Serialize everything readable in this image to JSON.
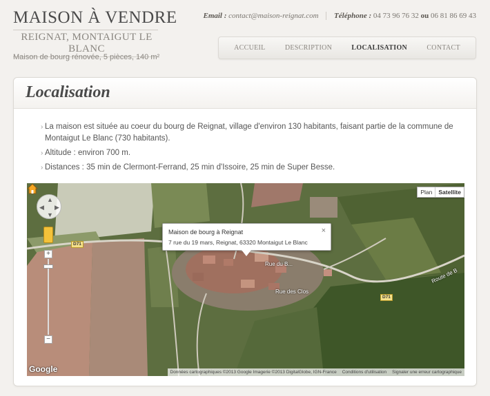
{
  "header": {
    "title": "MAISON À VENDRE",
    "subtitle": "REIGNAT, MONTAIGUT LE BLANC",
    "tagline": "Maison de bourg rénovée, 5 pièces, 140 m²",
    "email_label": "Email :",
    "email": "contact@maison-reignat.com",
    "phone_label": "Téléphone :",
    "phone1": "04 73 96 76 32",
    "or": "ou",
    "phone2": "06 81 86 69 43"
  },
  "nav": {
    "items": [
      "ACCUEIL",
      "DESCRIPTION",
      "LOCALISATION",
      "CONTACT"
    ],
    "active": "LOCALISATION"
  },
  "section": {
    "title": "Localisation",
    "bullets": [
      "La maison est située au coeur du bourg de Reignat, village d'environ 130 habitants, faisant partie de la commune de Montaigut Le Blanc (730 habitants).",
      "Altitude : environ 700 m.",
      "Distances : 35 min de Clermont-Ferrand, 25 min d'Issoire, 25 min de Super Besse."
    ]
  },
  "map": {
    "type_plan": "Plan",
    "type_satellite": "Satellite",
    "info_title": "Maison de bourg à Reignat",
    "info_address": "7 rue du 19 mars, Reignat, 63320 Montaigut Le Blanc",
    "close": "×",
    "zoom_in": "+",
    "zoom_out": "−",
    "road_d71_a": "D71",
    "road_d71_b": "D71",
    "street_rue": "Rue du B...",
    "street_route": "Route de B",
    "street_clos": "Rue des Clos",
    "google": "Google",
    "attribution": "Données cartographiques ©2013 Google Imagerie ©2013 DigitalGlobe, IGN-France",
    "terms": "Conditions d'utilisation",
    "report": "Signaler une erreur cartographique"
  }
}
